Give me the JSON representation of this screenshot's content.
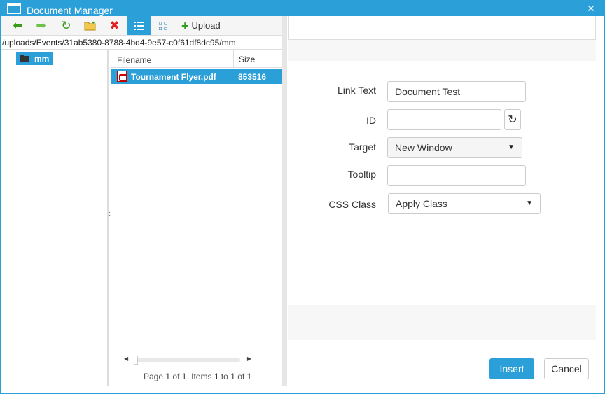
{
  "window": {
    "title": "Document Manager",
    "close_glyph": "✕"
  },
  "toolbar": {
    "back_icon": "arrow-left-icon",
    "forward_icon": "arrow-right-icon",
    "refresh_icon": "refresh-icon",
    "new_folder_icon": "new-folder-icon",
    "delete_icon": "delete-icon",
    "list_view_icon": "list-view-icon",
    "thumbnail_view_icon": "thumbnail-view-icon",
    "upload_label": "Upload"
  },
  "path": "/uploads/Events/31ab5380-8788-4bd4-9e57-c0f61df8dc95/mm",
  "tree": {
    "items": [
      {
        "label": "mm",
        "selected": true
      }
    ]
  },
  "file_list": {
    "columns": [
      "Filename",
      "Size"
    ],
    "rows": [
      {
        "name": "Tournament Flyer.pdf",
        "size": "853516",
        "selected": true
      }
    ]
  },
  "pager": {
    "page_word": "Page",
    "page": "1",
    "of_word": "of",
    "total_pages": "1",
    "items_word": ". Items",
    "from": "1",
    "to_word": "to",
    "to": "1",
    "of_word2": "of",
    "total_items": "1"
  },
  "form": {
    "link_text_label": "Link Text",
    "link_text_value": "Document Test",
    "id_label": "ID",
    "id_value": "",
    "target_label": "Target",
    "target_value": "New Window",
    "tooltip_label": "Tooltip",
    "tooltip_value": "",
    "css_class_label": "CSS Class",
    "css_class_value": "Apply Class"
  },
  "buttons": {
    "insert": "Insert",
    "cancel": "Cancel"
  },
  "colors": {
    "accent": "#2a9fd8"
  }
}
